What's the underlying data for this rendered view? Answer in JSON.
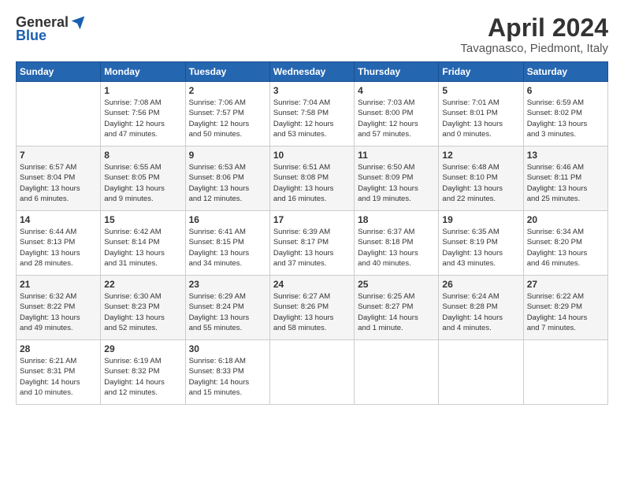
{
  "header": {
    "logo_general": "General",
    "logo_blue": "Blue",
    "title": "April 2024",
    "location": "Tavagnasco, Piedmont, Italy"
  },
  "days_of_week": [
    "Sunday",
    "Monday",
    "Tuesday",
    "Wednesday",
    "Thursday",
    "Friday",
    "Saturday"
  ],
  "weeks": [
    [
      {
        "day": "",
        "info": ""
      },
      {
        "day": "1",
        "info": "Sunrise: 7:08 AM\nSunset: 7:56 PM\nDaylight: 12 hours\nand 47 minutes."
      },
      {
        "day": "2",
        "info": "Sunrise: 7:06 AM\nSunset: 7:57 PM\nDaylight: 12 hours\nand 50 minutes."
      },
      {
        "day": "3",
        "info": "Sunrise: 7:04 AM\nSunset: 7:58 PM\nDaylight: 12 hours\nand 53 minutes."
      },
      {
        "day": "4",
        "info": "Sunrise: 7:03 AM\nSunset: 8:00 PM\nDaylight: 12 hours\nand 57 minutes."
      },
      {
        "day": "5",
        "info": "Sunrise: 7:01 AM\nSunset: 8:01 PM\nDaylight: 13 hours\nand 0 minutes."
      },
      {
        "day": "6",
        "info": "Sunrise: 6:59 AM\nSunset: 8:02 PM\nDaylight: 13 hours\nand 3 minutes."
      }
    ],
    [
      {
        "day": "7",
        "info": "Sunrise: 6:57 AM\nSunset: 8:04 PM\nDaylight: 13 hours\nand 6 minutes."
      },
      {
        "day": "8",
        "info": "Sunrise: 6:55 AM\nSunset: 8:05 PM\nDaylight: 13 hours\nand 9 minutes."
      },
      {
        "day": "9",
        "info": "Sunrise: 6:53 AM\nSunset: 8:06 PM\nDaylight: 13 hours\nand 12 minutes."
      },
      {
        "day": "10",
        "info": "Sunrise: 6:51 AM\nSunset: 8:08 PM\nDaylight: 13 hours\nand 16 minutes."
      },
      {
        "day": "11",
        "info": "Sunrise: 6:50 AM\nSunset: 8:09 PM\nDaylight: 13 hours\nand 19 minutes."
      },
      {
        "day": "12",
        "info": "Sunrise: 6:48 AM\nSunset: 8:10 PM\nDaylight: 13 hours\nand 22 minutes."
      },
      {
        "day": "13",
        "info": "Sunrise: 6:46 AM\nSunset: 8:11 PM\nDaylight: 13 hours\nand 25 minutes."
      }
    ],
    [
      {
        "day": "14",
        "info": "Sunrise: 6:44 AM\nSunset: 8:13 PM\nDaylight: 13 hours\nand 28 minutes."
      },
      {
        "day": "15",
        "info": "Sunrise: 6:42 AM\nSunset: 8:14 PM\nDaylight: 13 hours\nand 31 minutes."
      },
      {
        "day": "16",
        "info": "Sunrise: 6:41 AM\nSunset: 8:15 PM\nDaylight: 13 hours\nand 34 minutes."
      },
      {
        "day": "17",
        "info": "Sunrise: 6:39 AM\nSunset: 8:17 PM\nDaylight: 13 hours\nand 37 minutes."
      },
      {
        "day": "18",
        "info": "Sunrise: 6:37 AM\nSunset: 8:18 PM\nDaylight: 13 hours\nand 40 minutes."
      },
      {
        "day": "19",
        "info": "Sunrise: 6:35 AM\nSunset: 8:19 PM\nDaylight: 13 hours\nand 43 minutes."
      },
      {
        "day": "20",
        "info": "Sunrise: 6:34 AM\nSunset: 8:20 PM\nDaylight: 13 hours\nand 46 minutes."
      }
    ],
    [
      {
        "day": "21",
        "info": "Sunrise: 6:32 AM\nSunset: 8:22 PM\nDaylight: 13 hours\nand 49 minutes."
      },
      {
        "day": "22",
        "info": "Sunrise: 6:30 AM\nSunset: 8:23 PM\nDaylight: 13 hours\nand 52 minutes."
      },
      {
        "day": "23",
        "info": "Sunrise: 6:29 AM\nSunset: 8:24 PM\nDaylight: 13 hours\nand 55 minutes."
      },
      {
        "day": "24",
        "info": "Sunrise: 6:27 AM\nSunset: 8:26 PM\nDaylight: 13 hours\nand 58 minutes."
      },
      {
        "day": "25",
        "info": "Sunrise: 6:25 AM\nSunset: 8:27 PM\nDaylight: 14 hours\nand 1 minute."
      },
      {
        "day": "26",
        "info": "Sunrise: 6:24 AM\nSunset: 8:28 PM\nDaylight: 14 hours\nand 4 minutes."
      },
      {
        "day": "27",
        "info": "Sunrise: 6:22 AM\nSunset: 8:29 PM\nDaylight: 14 hours\nand 7 minutes."
      }
    ],
    [
      {
        "day": "28",
        "info": "Sunrise: 6:21 AM\nSunset: 8:31 PM\nDaylight: 14 hours\nand 10 minutes."
      },
      {
        "day": "29",
        "info": "Sunrise: 6:19 AM\nSunset: 8:32 PM\nDaylight: 14 hours\nand 12 minutes."
      },
      {
        "day": "30",
        "info": "Sunrise: 6:18 AM\nSunset: 8:33 PM\nDaylight: 14 hours\nand 15 minutes."
      },
      {
        "day": "",
        "info": ""
      },
      {
        "day": "",
        "info": ""
      },
      {
        "day": "",
        "info": ""
      },
      {
        "day": "",
        "info": ""
      }
    ]
  ]
}
